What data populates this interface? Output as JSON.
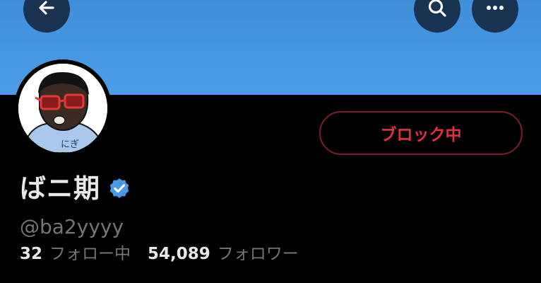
{
  "profile": {
    "display_name": "ばニ期",
    "handle": "@ba2yyyy",
    "verified": true,
    "avatar_badge_text": "にぎ"
  },
  "actions": {
    "block_label": "ブロック中"
  },
  "stats": {
    "following_count": "32",
    "following_label": "フォロー中",
    "followers_count": "54,089",
    "followers_label": "フォロワー"
  },
  "icons": {
    "back": "back-arrow-icon",
    "search": "search-icon",
    "more": "more-options-icon",
    "verified": "verified-badge-icon"
  },
  "colors": {
    "banner": "#4a9de6",
    "block_red": "#e0313d",
    "verified_blue": "#4a99e9",
    "muted_text": "#71767b"
  }
}
